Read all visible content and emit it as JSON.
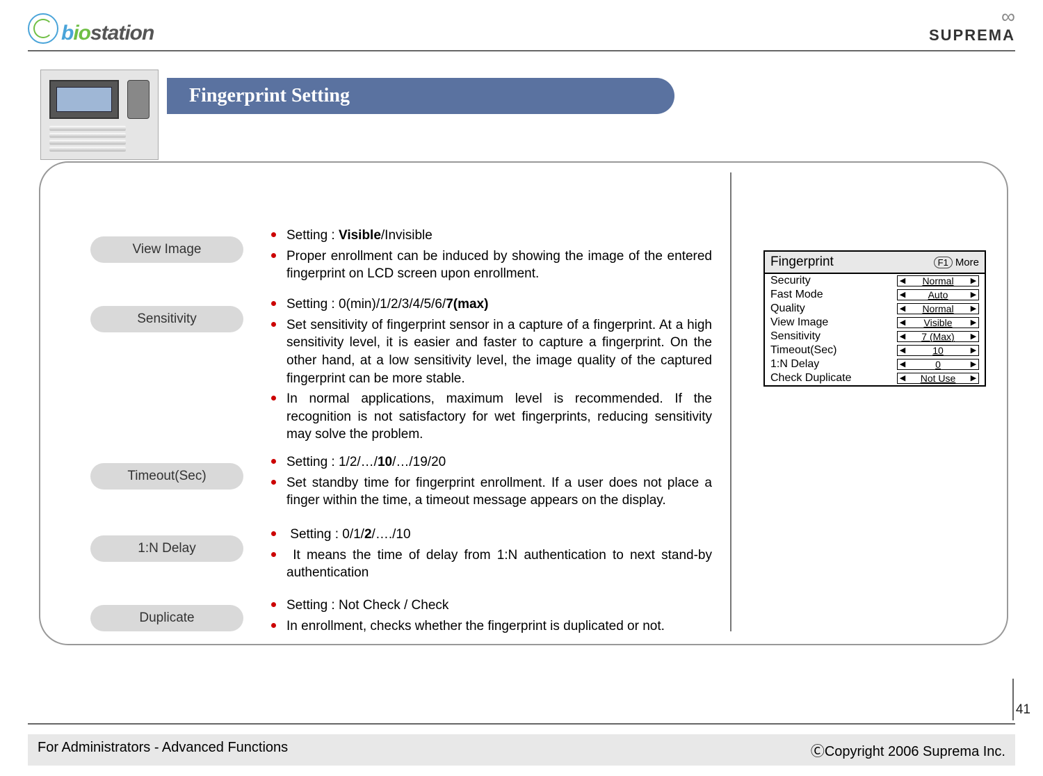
{
  "header": {
    "product_logo_prefix": "b",
    "product_logo_mid": "io",
    "product_logo_rest": "station",
    "company": "SUPREMA"
  },
  "title": "Fingerprint Setting",
  "pills": {
    "view_image": "View Image",
    "sensitivity": "Sensitivity",
    "timeout": "Timeout(Sec)",
    "delay": "1:N Delay",
    "duplicate": "Duplicate"
  },
  "sections": {
    "view_image": {
      "l1a": "Setting : ",
      "l1b": "Visible",
      "l1c": "/Invisible",
      "l2": "Proper enrollment can be induced by showing the image of the entered fingerprint on LCD screen upon enrollment."
    },
    "sensitivity": {
      "l1a": "Setting : 0(min)/1/2/3/4/5/6/",
      "l1b": "7(max)",
      "l2": "Set sensitivity of fingerprint sensor in a capture of a fingerprint. At a high sensitivity level, it is easier and faster to capture a fingerprint. On the other hand, at a low sensitivity level, the image quality of the captured fingerprint can be more stable.",
      "l3": "In normal applications, maximum level is recommended. If the recognition is not satisfactory for wet fingerprints, reducing sensitivity may solve the problem."
    },
    "timeout": {
      "l1a": "Setting : 1/2/…/",
      "l1b": "10",
      "l1c": "/…/19/20",
      "l2": "Set standby time for fingerprint enrollment. If a user does not place a finger within the time, a timeout message appears on the display."
    },
    "delay": {
      "l1a": "Setting : 0/1/",
      "l1b": "2",
      "l1c": "/…./10",
      "l2": "It means the time of delay from 1:N authentication to next stand-by authentication"
    },
    "duplicate": {
      "l1": "Setting : Not Check / Check",
      "l2": "In enrollment, checks whether the fingerprint is duplicated or not."
    }
  },
  "lcd": {
    "title": "Fingerprint",
    "more_key": "F1",
    "more_label": "More",
    "rows": [
      {
        "label": "Security",
        "value": "Normal"
      },
      {
        "label": "Fast Mode",
        "value": "Auto"
      },
      {
        "label": "Quality",
        "value": "Normal"
      },
      {
        "label": "View Image",
        "value": "Visible"
      },
      {
        "label": "Sensitivity",
        "value": "7 (Max)"
      },
      {
        "label": "Timeout(Sec)",
        "value": "10"
      },
      {
        "label": "1:N Delay",
        "value": "0"
      },
      {
        "label": "Check Duplicate",
        "value": "Not Use"
      }
    ]
  },
  "footer": {
    "left": "For Administrators - Advanced Functions",
    "right": "ⒸCopyright 2006 Suprema Inc.",
    "page": "41"
  }
}
